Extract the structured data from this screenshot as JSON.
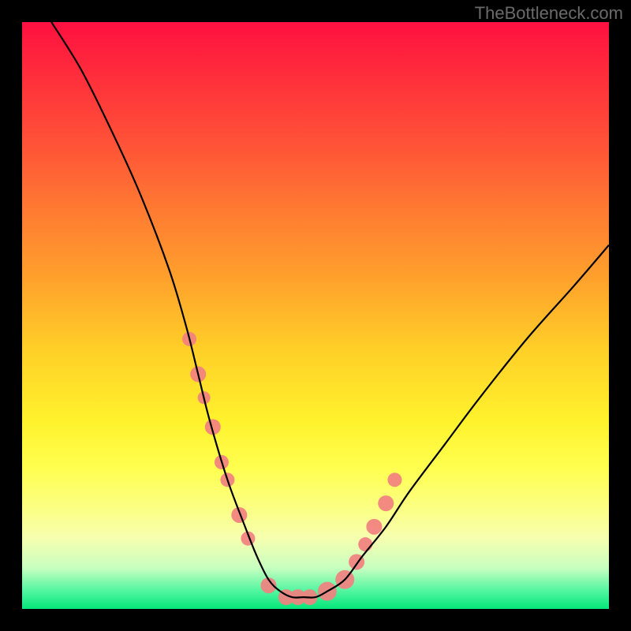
{
  "watermark": "TheBottleneck.com",
  "chart_data": {
    "type": "line",
    "title": "",
    "xlabel": "",
    "ylabel": "",
    "xlim": [
      0,
      100
    ],
    "ylim": [
      0,
      100
    ],
    "grid": false,
    "series": [
      {
        "name": "bottleneck-curve",
        "x": [
          5,
          10,
          15,
          20,
          25,
          28,
          30,
          32,
          35,
          38,
          40,
          42,
          44,
          46,
          48,
          50,
          52,
          55,
          58,
          62,
          66,
          72,
          78,
          86,
          94,
          100
        ],
        "values": [
          100,
          92,
          82,
          71,
          58,
          48,
          40,
          32,
          22,
          14,
          9,
          5,
          3,
          2,
          2,
          2,
          3,
          5,
          9,
          14,
          20,
          28,
          36,
          46,
          55,
          62
        ]
      }
    ],
    "markers": {
      "name": "highlight-dots",
      "x": [
        28.5,
        30,
        31,
        32.5,
        34,
        35,
        37,
        38.5,
        42,
        45,
        47,
        49,
        52,
        55,
        57,
        58.5,
        60,
        62,
        63.5
      ],
      "values": [
        46,
        40,
        36,
        31,
        25,
        22,
        16,
        12,
        4,
        2,
        2,
        2,
        3,
        5,
        8,
        11,
        14,
        18,
        22
      ],
      "color": "#f28080",
      "radius_values": [
        9,
        10,
        8,
        10,
        9,
        9,
        10,
        9,
        10,
        10,
        10,
        10,
        12,
        12,
        10,
        9,
        10,
        10,
        9
      ]
    },
    "colors": {
      "curve": "#000000",
      "marker": "#f28080"
    }
  }
}
